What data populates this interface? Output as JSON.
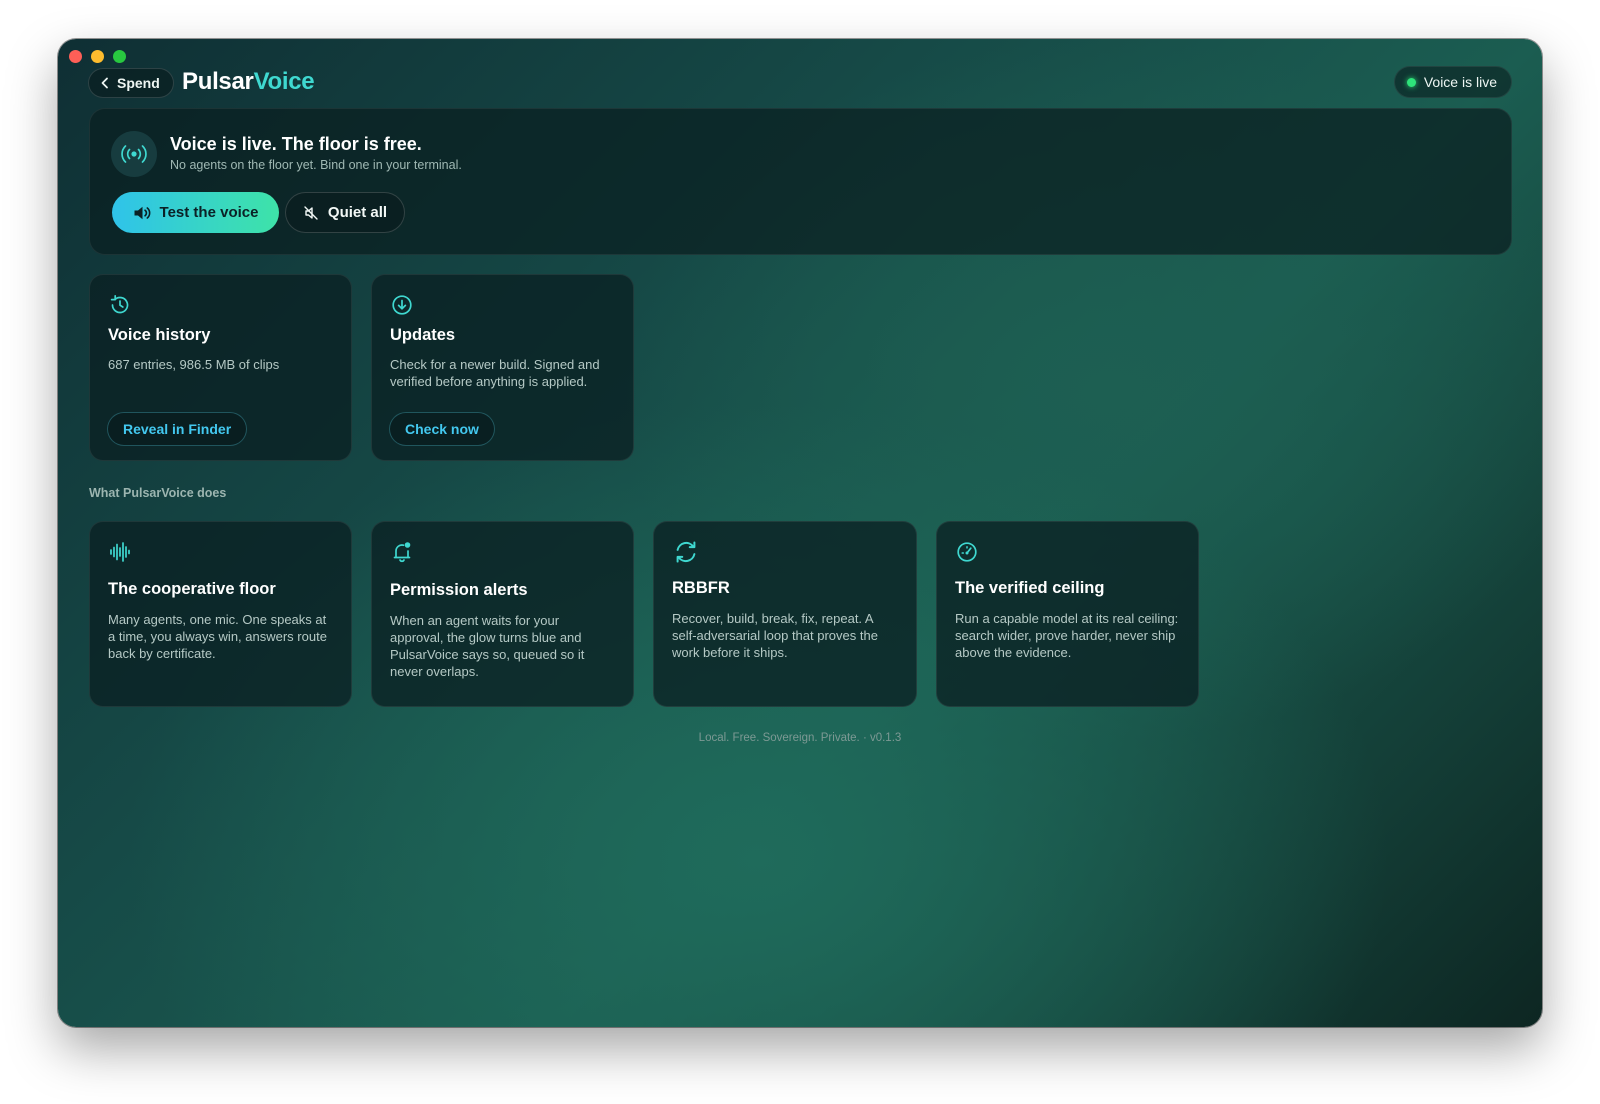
{
  "window": {
    "back_label": "Spend",
    "brand_part1": "Pulsar",
    "brand_part2": "Voice",
    "status_pill": "Voice is live"
  },
  "hero": {
    "title": "Voice is live. The floor is free.",
    "subtitle": "No agents on the floor yet. Bind one in your terminal.",
    "primary_button": "Test the voice",
    "secondary_button": "Quiet all"
  },
  "utility_cards": [
    {
      "icon": "history-icon",
      "title": "Voice history",
      "description": "687 entries, 986.5 MB of clips",
      "button": "Reveal in Finder"
    },
    {
      "icon": "download-icon",
      "title": "Updates",
      "description": "Check for a newer build. Signed and verified before anything is applied.",
      "button": "Check now"
    }
  ],
  "section_label": "What PulsarVoice does",
  "feature_cards": [
    {
      "icon": "waveform-icon",
      "title": "The cooperative floor",
      "description": "Many agents, one mic. One speaks at a time, you always win, answers route back by certificate."
    },
    {
      "icon": "bell-icon",
      "title": "Permission alerts",
      "description": "When an agent waits for your approval, the glow turns blue and PulsarVoice says so, queued so it never overlaps."
    },
    {
      "icon": "refresh-icon",
      "title": "RBBFR",
      "description": "Recover, build, break, fix, repeat. A self-adversarial loop that proves the work before it ships."
    },
    {
      "icon": "gauge-icon",
      "title": "The verified ceiling",
      "description": "Run a capable model at its real ceiling: search wider, prove harder, never ship above the evidence."
    }
  ],
  "footer": "Local. Free. Sovereign. Private.  ·  v0.1.3",
  "colors": {
    "accent_teal": "#3fd8d0",
    "accent_cyan": "#43c8ef",
    "live_green": "#2ee37a",
    "primary_gradient_start": "#2fc3ea",
    "primary_gradient_end": "#3ee3a8"
  }
}
